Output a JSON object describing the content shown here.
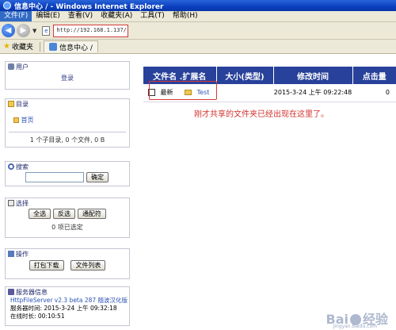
{
  "window": {
    "title": "信息中心 / - Windows Internet Explorer"
  },
  "menubar": {
    "items": [
      "文件(F)",
      "编辑(E)",
      "查看(V)",
      "收藏夹(A)",
      "工具(T)",
      "帮助(H)"
    ]
  },
  "addressbar": {
    "url": "http://192.168.1.137/"
  },
  "favbar": {
    "favorites_label": "收藏夹",
    "tab_title": "信息中心 /"
  },
  "sidebar": {
    "user": {
      "title": "用户",
      "login_link": "登录"
    },
    "directory": {
      "title": "目录",
      "home_link": "首页",
      "summary": "1 个子目录, 0 个文件, 0 B"
    },
    "search": {
      "title": "搜索",
      "confirm_button": "确定"
    },
    "select": {
      "title": "选择",
      "buttons": [
        "全选",
        "反选",
        "通配符"
      ],
      "status": "0 项已选定"
    },
    "actions": {
      "title": "操作",
      "buttons": [
        "打包下载",
        "文件列表"
      ]
    },
    "server_info": {
      "title": "服务器信息",
      "version": "HttpFileServer v2.3 beta 287 随波汉化版",
      "server_time": "服务器时间: 2015-3-24 上午 09:32:18",
      "uptime": "在线时长: 00:10:51"
    }
  },
  "file_table": {
    "headers": [
      "文件名 .扩展名",
      "大小(类型)",
      "修改时间",
      "点击量"
    ],
    "rows": [
      {
        "badge": "最新",
        "name": "Test",
        "size": "",
        "modified": "2015-3-24 上午 09:22:48",
        "hits": "0"
      }
    ]
  },
  "annotation": "刚才共享的文件夹已经出现在这里了。",
  "watermark": {
    "text": "Bai",
    "text2": "经验",
    "sub": "jingyan.baidu.com"
  }
}
